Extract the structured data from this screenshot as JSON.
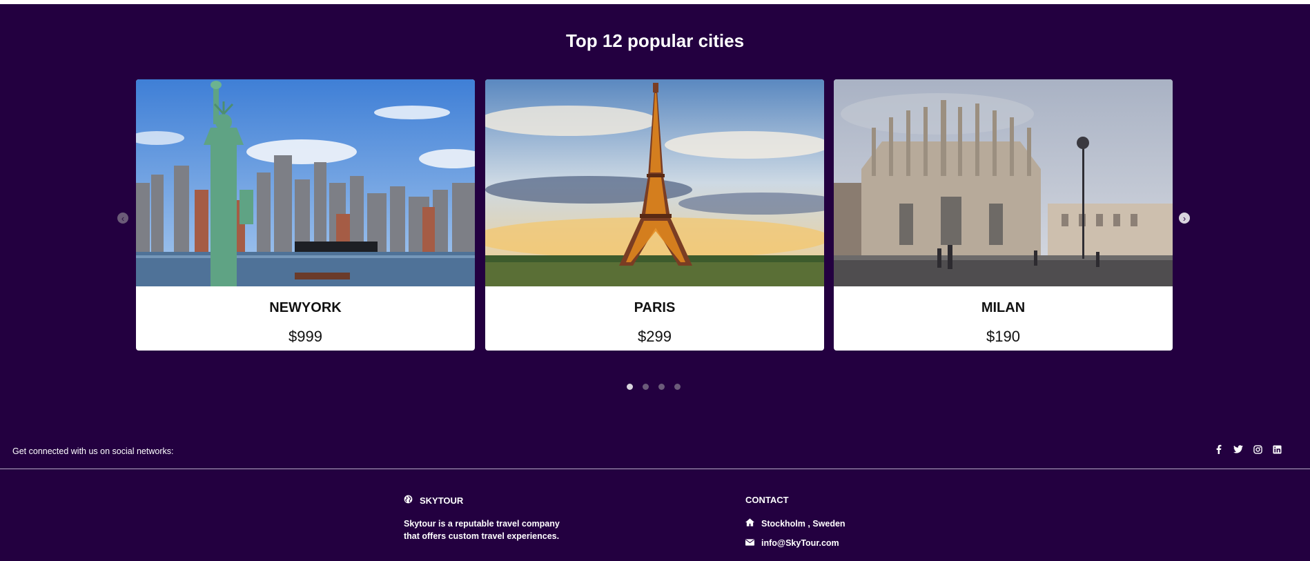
{
  "section": {
    "title": "Top 12 popular cities"
  },
  "carousel": {
    "cards": [
      {
        "city": "NEWYORK",
        "price": "$999"
      },
      {
        "city": "PARIS",
        "price": "$299"
      },
      {
        "city": "MILAN",
        "price": "$190"
      }
    ],
    "dots": 4,
    "active_dot": 0
  },
  "social": {
    "text": "Get connected with us on social networks:",
    "icons": [
      "facebook-icon",
      "twitter-icon",
      "instagram-icon",
      "linkedin-icon"
    ]
  },
  "footer": {
    "brand": {
      "title": "SKYTOUR",
      "description": "Skytour is a reputable travel company that offers custom travel experiences."
    },
    "contact": {
      "title": "CONTACT",
      "address": "Stockholm , Sweden",
      "email": "info@SkyTour.com"
    }
  },
  "colors": {
    "background": "#230040",
    "accent_text": "#ffffff"
  }
}
